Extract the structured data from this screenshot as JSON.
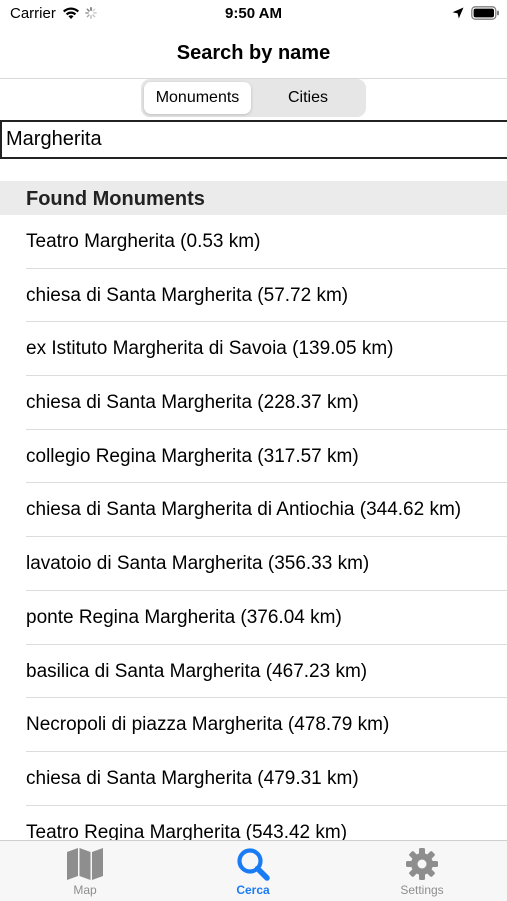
{
  "status_bar": {
    "carrier": "Carrier",
    "time": "9:50 AM"
  },
  "nav": {
    "title": "Search by name"
  },
  "segmented": {
    "options": [
      "Monuments",
      "Cities"
    ],
    "selected": "Monuments"
  },
  "search": {
    "value": "Margherita"
  },
  "section": {
    "title": "Found Monuments"
  },
  "results": [
    "Teatro Margherita (0.53 km)",
    "chiesa di Santa Margherita (57.72 km)",
    "ex Istituto Margherita di Savoia (139.05 km)",
    "chiesa di Santa Margherita (228.37 km)",
    "collegio Regina Margherita (317.57 km)",
    "chiesa di Santa Margherita di Antiochia (344.62 km)",
    "lavatoio di Santa Margherita (356.33 km)",
    "ponte Regina Margherita (376.04 km)",
    "basilica di Santa Margherita (467.23 km)",
    "Necropoli di piazza Margherita (478.79 km)",
    "chiesa di Santa Margherita (479.31 km)",
    "Teatro Regina Margherita (543.42 km)"
  ],
  "tabs": [
    {
      "label": "Map",
      "icon": "map-icon"
    },
    {
      "label": "Cerca",
      "icon": "search-icon",
      "active": true
    },
    {
      "label": "Settings",
      "icon": "gear-icon"
    }
  ],
  "colors": {
    "accent": "#1a7cf5",
    "inactive": "#8e8e8e"
  }
}
